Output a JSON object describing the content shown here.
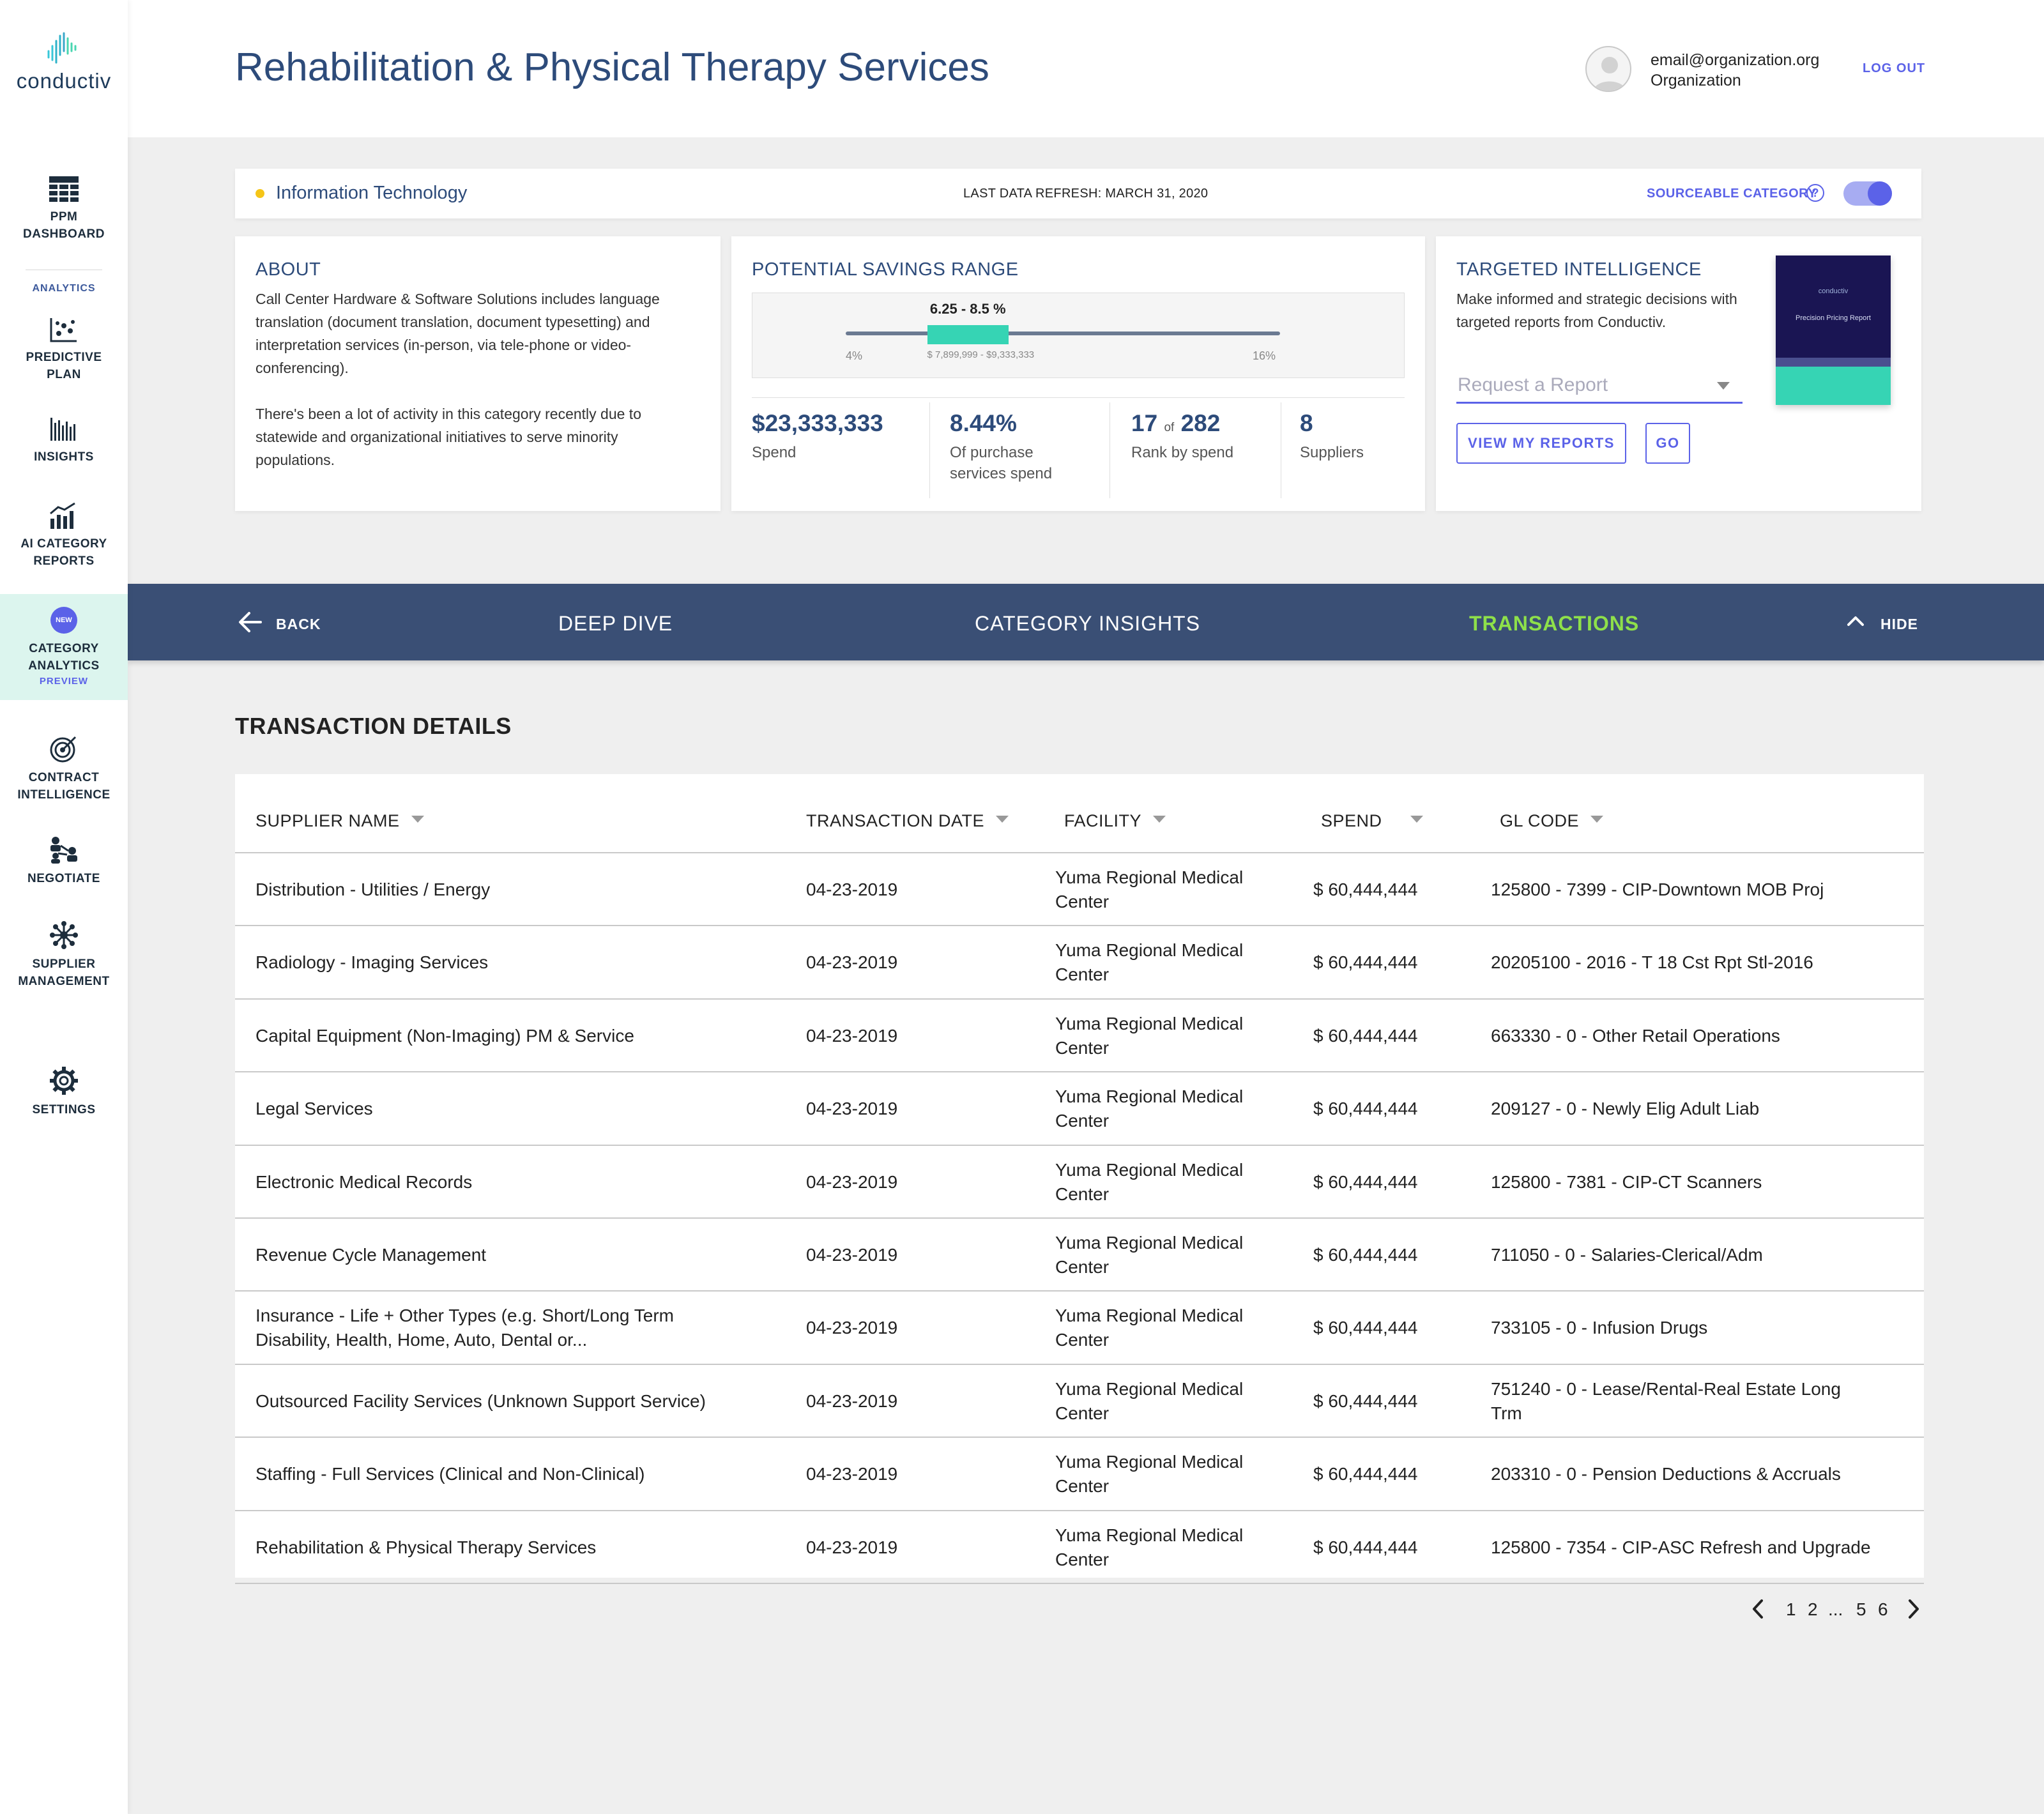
{
  "brand": {
    "name": "conductiv"
  },
  "sidebar": {
    "analytics_label": "ANALYTICS",
    "items": [
      {
        "label": "PPM\nDASHBOARD",
        "icon": "dashboard-grid-icon"
      },
      {
        "label": "PREDICTIVE\nPLAN",
        "icon": "scatter-plot-icon"
      },
      {
        "label": "INSIGHTS",
        "icon": "bar-code-chart-icon"
      },
      {
        "label": "AI CATEGORY\nREPORTS",
        "icon": "bar-trend-chart-icon"
      },
      {
        "label": "CATEGORY\nANALYTICS",
        "icon": "new-badge",
        "badge": "NEW",
        "sublabel": "PREVIEW",
        "active": true
      },
      {
        "label": "CONTRACT\nINTELLIGENCE",
        "icon": "target-icon"
      },
      {
        "label": "NEGOTIATE",
        "icon": "people-network-icon"
      },
      {
        "label": "SUPPLIER\nMANAGEMENT",
        "icon": "snowflake-network-icon"
      },
      {
        "label": "SETTINGS",
        "icon": "gear-icon"
      }
    ]
  },
  "header": {
    "title": "Rehabilitation & Physical Therapy Services",
    "user_email": "email@organization.org",
    "user_org": "Organization",
    "logout_label": "LOG OUT"
  },
  "category_bar": {
    "category": "Information Technology",
    "refresh": "LAST DATA REFRESH: MARCH 31, 2020",
    "sourceable_label": "SOURCEABLE CATEGORY",
    "help_glyph": "?",
    "sourceable_on": true
  },
  "about": {
    "title": "ABOUT",
    "paragraph1": "Call Center Hardware & Software Solutions includes language translation (document translation, document typesetting) and interpretation services (in-person, via tele-phone or video-conferencing).",
    "paragraph2": "There's been a lot of activity in this category recently due to statewide and organizational initiatives to serve minority populations."
  },
  "savings": {
    "title": "POTENTIAL SAVINGS RANGE",
    "range_label": "6.25 - 8.5 %",
    "range_min": "4%",
    "range_max": "16%",
    "range_dollars": "$ 7,899,999 - $9,333,333",
    "range_low_pct": 6.25,
    "range_high_pct": 8.5,
    "scale_min_pct": 4,
    "scale_max_pct": 16,
    "stats": [
      {
        "value": "$23,333,333",
        "label": "Spend"
      },
      {
        "value": "8.44%",
        "label": "Of purchase services spend"
      },
      {
        "value": "17",
        "of": "of",
        "total": "282",
        "label": "Rank by spend"
      },
      {
        "value": "8",
        "label": "Suppliers"
      }
    ]
  },
  "intel": {
    "title": "TARGETED INTELLIGENCE",
    "text": "Make informed and strategic decisions with targeted reports from Conductiv.",
    "select_placeholder": "Request a Report",
    "view_reports_label": "VIEW MY REPORTS",
    "go_label": "GO",
    "thumb_brand": "conductiv",
    "thumb_title": "Precision Pricing Report"
  },
  "navband": {
    "back_label": "BACK",
    "tabs": [
      "DEEP DIVE",
      "CATEGORY INSIGHTS",
      "TRANSACTIONS"
    ],
    "active_tab": "TRANSACTIONS",
    "hide_label": "HIDE"
  },
  "transactions": {
    "title": "TRANSACTION DETAILS",
    "columns": [
      "SUPPLIER NAME",
      "TRANSACTION DATE",
      "FACILITY",
      "SPEND",
      "GL CODE"
    ],
    "rows": [
      {
        "supplier": "Distribution - Utilities / Energy",
        "date": "04-23-2019",
        "facility": "Yuma Regional Medical Center",
        "spend": "$ 60,444,444",
        "gl": "125800 - 7399 - CIP-Downtown MOB Proj"
      },
      {
        "supplier": "Radiology - Imaging Services",
        "date": "04-23-2019",
        "facility": "Yuma Regional Medical Center",
        "spend": "$ 60,444,444",
        "gl": "20205100 - 2016 - T 18 Cst Rpt Stl-2016"
      },
      {
        "supplier": "Capital Equipment (Non-Imaging) PM & Service",
        "date": "04-23-2019",
        "facility": "Yuma Regional Medical Center",
        "spend": "$ 60,444,444",
        "gl": "663330 - 0 - Other Retail Operations"
      },
      {
        "supplier": "Legal Services",
        "date": "04-23-2019",
        "facility": "Yuma Regional Medical Center",
        "spend": "$ 60,444,444",
        "gl": "209127 - 0 - Newly Elig Adult Liab"
      },
      {
        "supplier": "Electronic Medical Records",
        "date": "04-23-2019",
        "facility": "Yuma Regional Medical Center",
        "spend": "$ 60,444,444",
        "gl": "125800 - 7381 - CIP-CT Scanners"
      },
      {
        "supplier": "Revenue Cycle Management",
        "date": "04-23-2019",
        "facility": "Yuma Regional Medical Center",
        "spend": "$ 60,444,444",
        "gl": "711050 - 0 - Salaries-Clerical/Adm"
      },
      {
        "supplier": "Insurance - Life + Other Types (e.g. Short/Long Term Disability, Health, Home, Auto, Dental or...",
        "date": "04-23-2019",
        "facility": "Yuma Regional Medical Center",
        "spend": "$ 60,444,444",
        "gl": "733105 - 0 - Infusion Drugs"
      },
      {
        "supplier": "Outsourced Facility Services (Unknown Support Service)",
        "date": "04-23-2019",
        "facility": "Yuma Regional Medical Center",
        "spend": "$ 60,444,444",
        "gl": "751240 - 0 - Lease/Rental-Real Estate Long Trm"
      },
      {
        "supplier": "Staffing - Full Services (Clinical and Non-Clinical)",
        "date": "04-23-2019",
        "facility": "Yuma Regional Medical Center",
        "spend": "$ 60,444,444",
        "gl": "203310 - 0 - Pension Deductions & Accruals"
      },
      {
        "supplier": "Rehabilitation & Physical Therapy Services",
        "date": "04-23-2019",
        "facility": "Yuma Regional Medical Center",
        "spend": "$ 60,444,444",
        "gl": "125800 - 7354 - CIP-ASC Refresh and Upgrade"
      }
    ]
  },
  "pagination": {
    "pages": [
      "1",
      "2",
      "...",
      "5",
      "6"
    ]
  },
  "colors": {
    "accent": "#5b62e8",
    "navy": "#2d4b7a",
    "band": "#3a4f75",
    "active_tab": "#8ee04a",
    "teal": "#36d4b4",
    "category_dot": "#f5c518"
  }
}
